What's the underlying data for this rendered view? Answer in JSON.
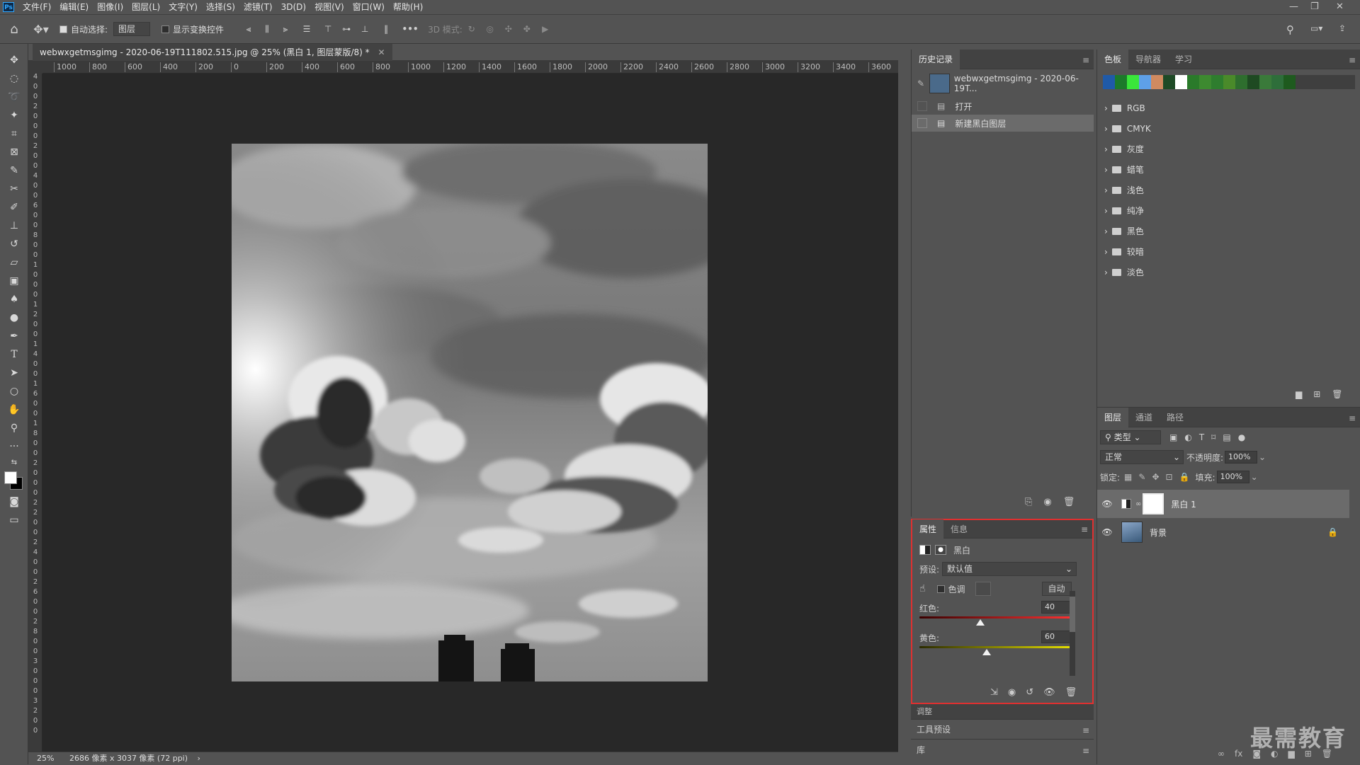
{
  "app": {
    "logo": "Ps"
  },
  "menu": [
    "文件(F)",
    "编辑(E)",
    "图像(I)",
    "图层(L)",
    "文字(Y)",
    "选择(S)",
    "滤镜(T)",
    "3D(D)",
    "视图(V)",
    "窗口(W)",
    "帮助(H)"
  ],
  "options_bar": {
    "auto_select_label": "自动选择:",
    "auto_select_checked": true,
    "auto_select_target": "图层",
    "show_transform_label": "显示变换控件",
    "show_transform_checked": false,
    "mode_3d_label": "3D 模式:"
  },
  "document": {
    "tab_title": "webwxgetmsgimg - 2020-06-19T111802.515.jpg @ 25% (黑白 1, 图层蒙版/8) *",
    "ruler_h_labels": [
      "1000",
      "800",
      "600",
      "400",
      "200",
      "0",
      "200",
      "400",
      "600",
      "800",
      "1000",
      "1200",
      "1400",
      "1600",
      "1800",
      "2000",
      "2200",
      "2400",
      "2600",
      "2800",
      "3000",
      "3200",
      "3400",
      "3600"
    ],
    "ruler_v_labels": [
      "4",
      "0",
      "0",
      "2",
      "0",
      "0",
      "0",
      "2",
      "0",
      "0",
      "4",
      "0",
      "0",
      "6",
      "0",
      "0",
      "8",
      "0",
      "0",
      "1",
      "0",
      "0",
      "0",
      "1",
      "2",
      "0",
      "0",
      "1",
      "4",
      "0",
      "0",
      "1",
      "6",
      "0",
      "0",
      "1",
      "8",
      "0",
      "0",
      "2",
      "0",
      "0",
      "0",
      "2",
      "2",
      "0",
      "0",
      "2",
      "4",
      "0",
      "0",
      "2",
      "6",
      "0",
      "0",
      "2",
      "8",
      "0",
      "0",
      "3",
      "0",
      "0",
      "0",
      "3",
      "2",
      "0",
      "0"
    ],
    "zoom": "25%",
    "size_info": "2686 像素 x 3037 像素 (72 ppi)"
  },
  "history": {
    "tab": "历史记录",
    "snapshot": "webwxgetmsgimg - 2020-06-19T...",
    "items": [
      "打开",
      "新建黑白图层"
    ],
    "selected_index": 1
  },
  "properties": {
    "tabs": [
      "属性",
      "信息"
    ],
    "type_label": "黑白",
    "preset_label": "预设:",
    "preset_value": "默认值",
    "tint_label": "色调",
    "auto_label": "自动",
    "sliders": [
      {
        "label": "红色:",
        "value": "40",
        "fraction": 0.4,
        "gradient_from": "#3a0000",
        "gradient_to": "#ff3030"
      },
      {
        "label": "黄色:",
        "value": "60",
        "fraction": 0.44,
        "gradient_from": "#2a2a00",
        "gradient_to": "#e6e000"
      }
    ]
  },
  "collapsed_panels": [
    "调整",
    "工具预设",
    "库"
  ],
  "swatches": {
    "tabs": [
      "色板",
      "导航器",
      "学习"
    ],
    "recent_colors": [
      "#1f5aa8",
      "#1c7a2a",
      "#3ae63a",
      "#5ea0e8",
      "#d08a60",
      "#1e4a26",
      "#ffffff",
      "#2a7a2a",
      "#3d8a30",
      "#2e7d2e",
      "#4a8a2a",
      "#2e6e2e",
      "#1e4a22",
      "#3a7a3a",
      "#2e6e3a",
      "#1e5a1e"
    ],
    "groups": [
      "RGB",
      "CMYK",
      "灰度",
      "蜡笔",
      "浅色",
      "纯净",
      "黑色",
      "较暗",
      "淡色"
    ]
  },
  "layers": {
    "tabs": [
      "图层",
      "通道",
      "路径"
    ],
    "filter_label": "类型",
    "blend_mode": "正常",
    "opacity_label": "不透明度:",
    "opacity": "100%",
    "lock_label": "锁定:",
    "fill_label": "填充:",
    "fill": "100%",
    "items": [
      {
        "name": "黑白 1",
        "visible": true,
        "selected": true
      },
      {
        "name": "背景",
        "visible": true,
        "locked": true
      }
    ]
  },
  "watermark": "最需教育"
}
